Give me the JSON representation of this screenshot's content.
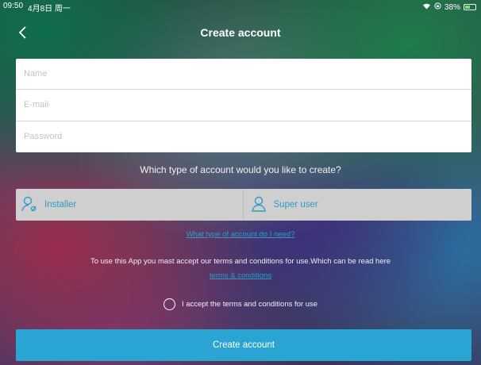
{
  "status_bar": {
    "time": "09:50",
    "date": "4月8日 周一",
    "battery": "38%"
  },
  "nav": {
    "title": "Create account"
  },
  "form": {
    "name_placeholder": "Name",
    "email_placeholder": "E-mail",
    "password_placeholder": "Password"
  },
  "account_type": {
    "question": "Which type of account would you like to create?",
    "options": [
      {
        "label": "Installer",
        "icon": "installer-user-icon"
      },
      {
        "label": "Super user",
        "icon": "user-icon"
      }
    ],
    "help_link": "What type of account do I need?"
  },
  "terms": {
    "text": "To use this App you mast accept our terms and conditions for use.Which can be read here",
    "link": "terms & conditions",
    "accept_label": "I accept the terms and conditions for use"
  },
  "create_button": {
    "label": "Create account"
  },
  "colors": {
    "accent": "#2aa4d2",
    "link": "#2e9bc8"
  }
}
